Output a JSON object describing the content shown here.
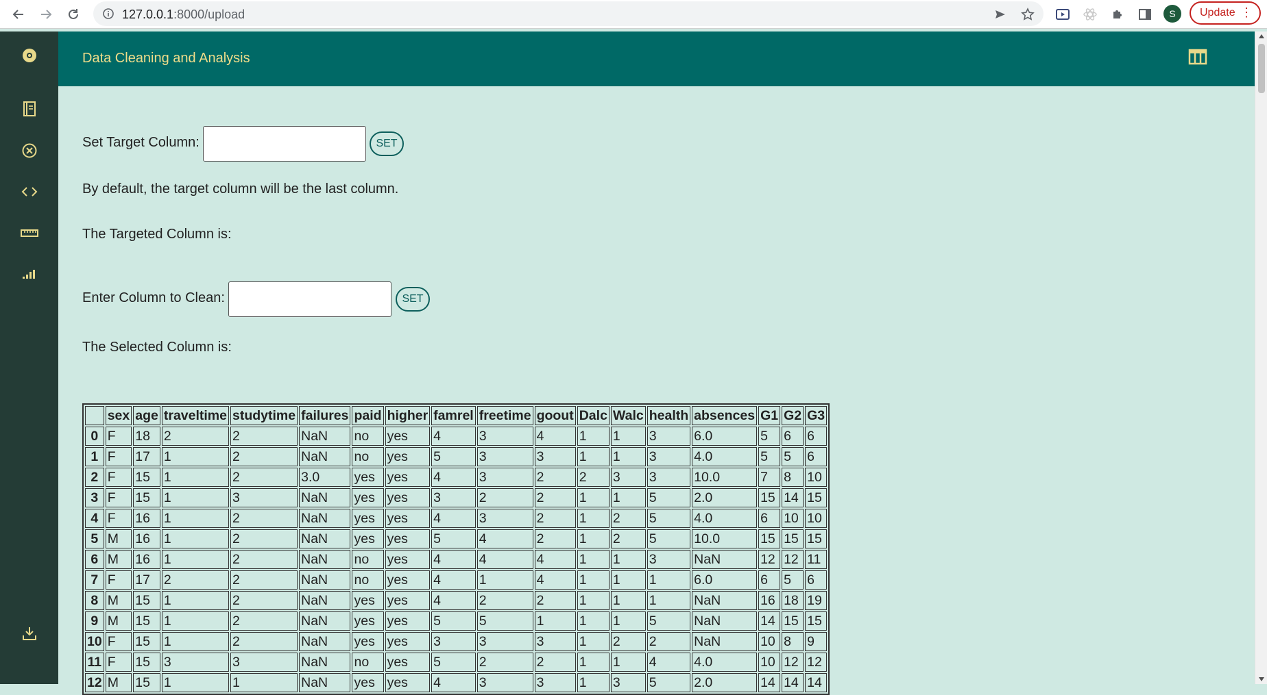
{
  "browser": {
    "url_host": "127.0.0.1",
    "url_path": ":8000/upload",
    "avatar_letter": "S",
    "update_label": "Update"
  },
  "app": {
    "title": "Data Cleaning and Analysis"
  },
  "sidebar": {
    "icons": [
      "settings-icon",
      "notebook-icon",
      "close-circle-icon",
      "code-icon",
      "ruler-icon",
      "bar-chart-icon",
      "download-icon"
    ]
  },
  "target": {
    "label": "Set Target Column:",
    "input_value": "",
    "button": "SET",
    "note": "By default, the target column will be the last column.",
    "targeted": "The Targeted Column is:"
  },
  "clean": {
    "label": "Enter Column to Clean:",
    "input_value": "",
    "button": "SET",
    "selected": "The Selected Column is:"
  },
  "table": {
    "columns": [
      "",
      "sex",
      "age",
      "traveltime",
      "studytime",
      "failures",
      "paid",
      "higher",
      "famrel",
      "freetime",
      "goout",
      "Dalc",
      "Walc",
      "health",
      "absences",
      "G1",
      "G2",
      "G3"
    ],
    "rows": [
      [
        "0",
        "F",
        "18",
        "2",
        "2",
        "NaN",
        "no",
        "yes",
        "4",
        "3",
        "4",
        "1",
        "1",
        "3",
        "6.0",
        "5",
        "6",
        "6"
      ],
      [
        "1",
        "F",
        "17",
        "1",
        "2",
        "NaN",
        "no",
        "yes",
        "5",
        "3",
        "3",
        "1",
        "1",
        "3",
        "4.0",
        "5",
        "5",
        "6"
      ],
      [
        "2",
        "F",
        "15",
        "1",
        "2",
        "3.0",
        "yes",
        "yes",
        "4",
        "3",
        "2",
        "2",
        "3",
        "3",
        "10.0",
        "7",
        "8",
        "10"
      ],
      [
        "3",
        "F",
        "15",
        "1",
        "3",
        "NaN",
        "yes",
        "yes",
        "3",
        "2",
        "2",
        "1",
        "1",
        "5",
        "2.0",
        "15",
        "14",
        "15"
      ],
      [
        "4",
        "F",
        "16",
        "1",
        "2",
        "NaN",
        "yes",
        "yes",
        "4",
        "3",
        "2",
        "1",
        "2",
        "5",
        "4.0",
        "6",
        "10",
        "10"
      ],
      [
        "5",
        "M",
        "16",
        "1",
        "2",
        "NaN",
        "yes",
        "yes",
        "5",
        "4",
        "2",
        "1",
        "2",
        "5",
        "10.0",
        "15",
        "15",
        "15"
      ],
      [
        "6",
        "M",
        "16",
        "1",
        "2",
        "NaN",
        "no",
        "yes",
        "4",
        "4",
        "4",
        "1",
        "1",
        "3",
        "NaN",
        "12",
        "12",
        "11"
      ],
      [
        "7",
        "F",
        "17",
        "2",
        "2",
        "NaN",
        "no",
        "yes",
        "4",
        "1",
        "4",
        "1",
        "1",
        "1",
        "6.0",
        "6",
        "5",
        "6"
      ],
      [
        "8",
        "M",
        "15",
        "1",
        "2",
        "NaN",
        "yes",
        "yes",
        "4",
        "2",
        "2",
        "1",
        "1",
        "1",
        "NaN",
        "16",
        "18",
        "19"
      ],
      [
        "9",
        "M",
        "15",
        "1",
        "2",
        "NaN",
        "yes",
        "yes",
        "5",
        "5",
        "1",
        "1",
        "1",
        "5",
        "NaN",
        "14",
        "15",
        "15"
      ],
      [
        "10",
        "F",
        "15",
        "1",
        "2",
        "NaN",
        "yes",
        "yes",
        "3",
        "3",
        "3",
        "1",
        "2",
        "2",
        "NaN",
        "10",
        "8",
        "9"
      ],
      [
        "11",
        "F",
        "15",
        "3",
        "3",
        "NaN",
        "no",
        "yes",
        "5",
        "2",
        "2",
        "1",
        "1",
        "4",
        "4.0",
        "10",
        "12",
        "12"
      ],
      [
        "12",
        "M",
        "15",
        "1",
        "1",
        "NaN",
        "yes",
        "yes",
        "4",
        "3",
        "3",
        "1",
        "3",
        "5",
        "2.0",
        "14",
        "14",
        "14"
      ]
    ]
  },
  "colors": {
    "sidebar_bg": "#243c36",
    "header_bg": "#006966",
    "content_bg": "#cfe9e2",
    "accent_text": "#eedc8a"
  }
}
